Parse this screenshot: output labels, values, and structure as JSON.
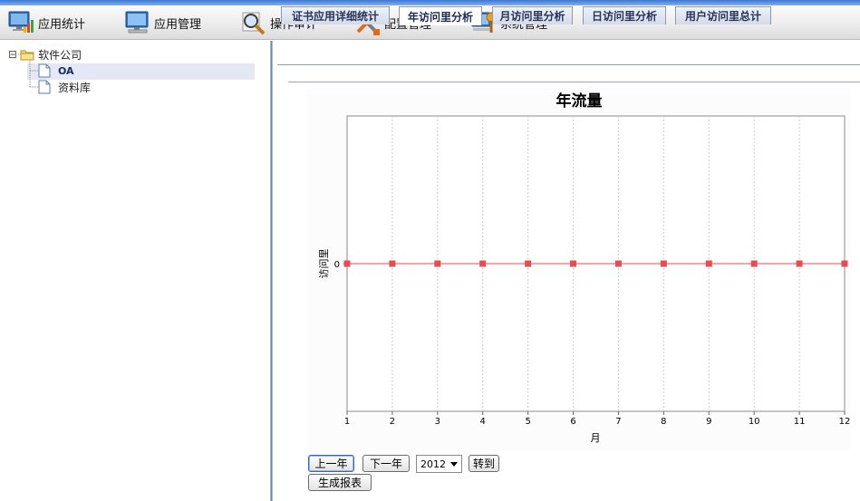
{
  "toolbar": {
    "items": [
      {
        "label": "应用统计",
        "icon": "monitor-chart-icon"
      },
      {
        "label": "应用管理",
        "icon": "monitor-icon"
      },
      {
        "label": "操作审计",
        "icon": "magnifier-icon"
      },
      {
        "label": "配置管理",
        "icon": "tools-icon"
      },
      {
        "label": "系统管理",
        "icon": "computer-settings-icon"
      }
    ]
  },
  "tree": {
    "root": {
      "label": "软件公司",
      "toggle": "⊟",
      "icon": "folder-icon"
    },
    "children": [
      {
        "label": "OA",
        "icon": "document-icon",
        "selected": true
      },
      {
        "label": "资料库",
        "icon": "document-icon",
        "selected": false
      }
    ]
  },
  "tabs": [
    {
      "label": "证书应用详细统计",
      "active": false
    },
    {
      "label": "年访问里分析",
      "active": true
    },
    {
      "label": "月访问里分析",
      "active": false
    },
    {
      "label": "日访问里分析",
      "active": false
    },
    {
      "label": "用户访问里总计",
      "active": false
    }
  ],
  "chart_data": {
    "type": "line",
    "title": "年流量",
    "xlabel": "月",
    "ylabel": "访问里",
    "x": [
      1,
      2,
      3,
      4,
      5,
      6,
      7,
      8,
      9,
      10,
      11,
      12
    ],
    "yticks": [
      "0"
    ],
    "series": [
      {
        "values": [
          0,
          0,
          0,
          0,
          0,
          0,
          0,
          0,
          0,
          0,
          0,
          0
        ],
        "color": "#e84c4c"
      }
    ],
    "grid": "vertical-dashed"
  },
  "controls": {
    "prev_label": "上一年",
    "next_label": "下一年",
    "year_value": "2012",
    "goto_label": "转到",
    "report_label": "生成报表"
  },
  "colors": {
    "accent": "#3a78d6",
    "series": "#e84c4c",
    "tab_text": "#26345a"
  }
}
